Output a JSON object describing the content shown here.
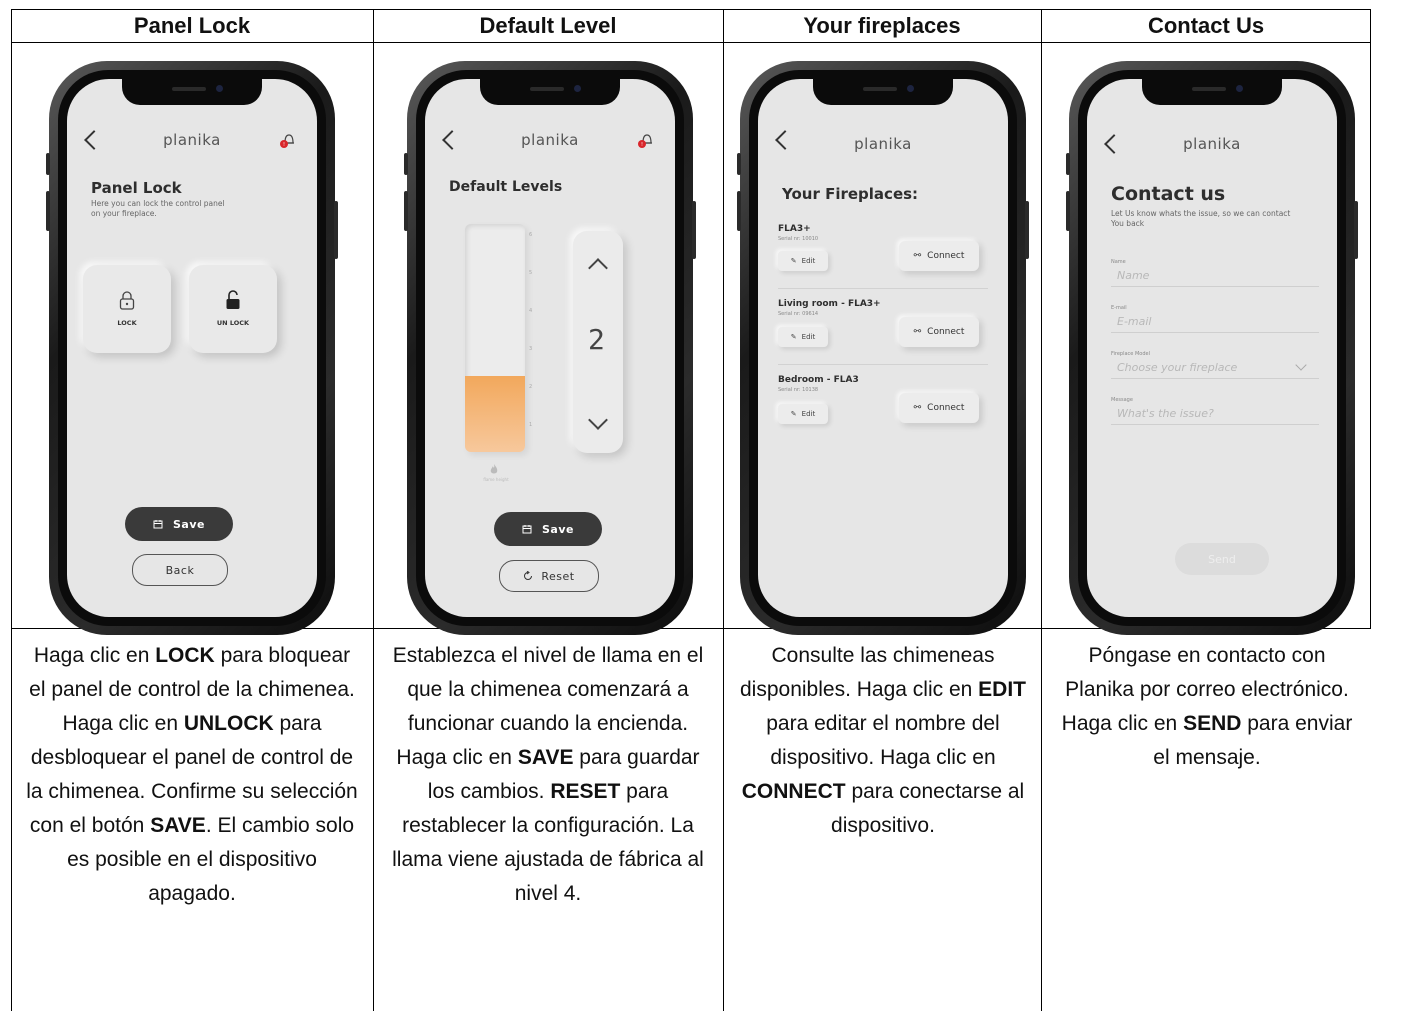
{
  "headers": [
    "Panel Lock",
    "Default Level",
    "Your fireplaces",
    "Contact Us"
  ],
  "descriptions": {
    "col1": [
      {
        "t": "Haga clic en ",
        "b": false
      },
      {
        "t": "LOCK",
        "b": true
      },
      {
        "t": " para bloquear el panel de control de la chimenea. Haga clic en ",
        "b": false
      },
      {
        "t": "UNLOCK",
        "b": true
      },
      {
        "t": " para desbloquear el panel de control de la chimenea. Confirme su selección con el botón ",
        "b": false
      },
      {
        "t": "SAVE",
        "b": true
      },
      {
        "t": ". El cambio solo es posible en el dispositivo apagado.",
        "b": false
      }
    ],
    "col2": [
      {
        "t": "Establezca el nivel de llama en el que la chimenea comenzará a funcionar cuando la encienda. Haga clic en ",
        "b": false
      },
      {
        "t": "SAVE",
        "b": true
      },
      {
        "t": " para guardar los cambios. ",
        "b": false
      },
      {
        "t": "RESET",
        "b": true
      },
      {
        "t": " para restablecer la configuración. La llama viene ajustada de fábrica al nivel 4.",
        "b": false
      }
    ],
    "col3": [
      {
        "t": "Consulte las chimeneas disponibles. Haga clic en ",
        "b": false
      },
      {
        "t": "EDIT",
        "b": true
      },
      {
        "t": " para editar el nombre del dispositivo. Haga clic en ",
        "b": false
      },
      {
        "t": "CONNECT",
        "b": true
      },
      {
        "t": " para conectarse al dispositivo.",
        "b": false
      }
    ],
    "col4": [
      {
        "t": "Póngase en contacto con Planika por correo electrónico. Haga clic en ",
        "b": false
      },
      {
        "t": "SEND",
        "b": true
      },
      {
        "t": " para enviar el mensaje.",
        "b": false
      }
    ]
  },
  "app": {
    "brand": "planika"
  },
  "panel_lock": {
    "title": "Panel Lock",
    "subtitle_line1": "Here you can lock the control panel",
    "subtitle_line2": "on your fireplace.",
    "lock_label": "LOCK",
    "unlock_label": "UN LOCK",
    "save_label": "Save",
    "back_label": "Back"
  },
  "default_level": {
    "title": "Default Levels",
    "ticks": [
      "6",
      "5",
      "4",
      "3",
      "2",
      "1"
    ],
    "level": 2,
    "level_max": 6,
    "digit": "2",
    "flame_caption": "flame height",
    "save_label": "Save",
    "reset_label": "Reset"
  },
  "fireplaces": {
    "title": "Your Fireplaces:",
    "edit_label": "Edit",
    "connect_label": "Connect",
    "items": [
      {
        "name": "FLA3+",
        "serial": "Serial nr: 10010"
      },
      {
        "name": "Living room - FLA3+",
        "serial": "Serial nr: 09614"
      },
      {
        "name": "Bedroom - FLA3",
        "serial": "Serial nr: 10138"
      }
    ]
  },
  "contact": {
    "title": "Contact us",
    "subtitle_line1": "Let Us know whats the issue, so we can contact",
    "subtitle_line2": "You back",
    "name_label": "Name",
    "name_placeholder": "Name",
    "email_label": "E-mail",
    "email_placeholder": "E-mail",
    "model_label": "Fireplace Model",
    "model_placeholder": "Choose your fireplace",
    "message_label": "Message",
    "message_placeholder": "What's the issue?",
    "send_label": "Send"
  },
  "colors": {
    "flame_bar": "#f2a85c",
    "dark_button": "#3a3a3a",
    "screen_bg": "#e6e6e6",
    "alert_red": "#d9262b"
  }
}
